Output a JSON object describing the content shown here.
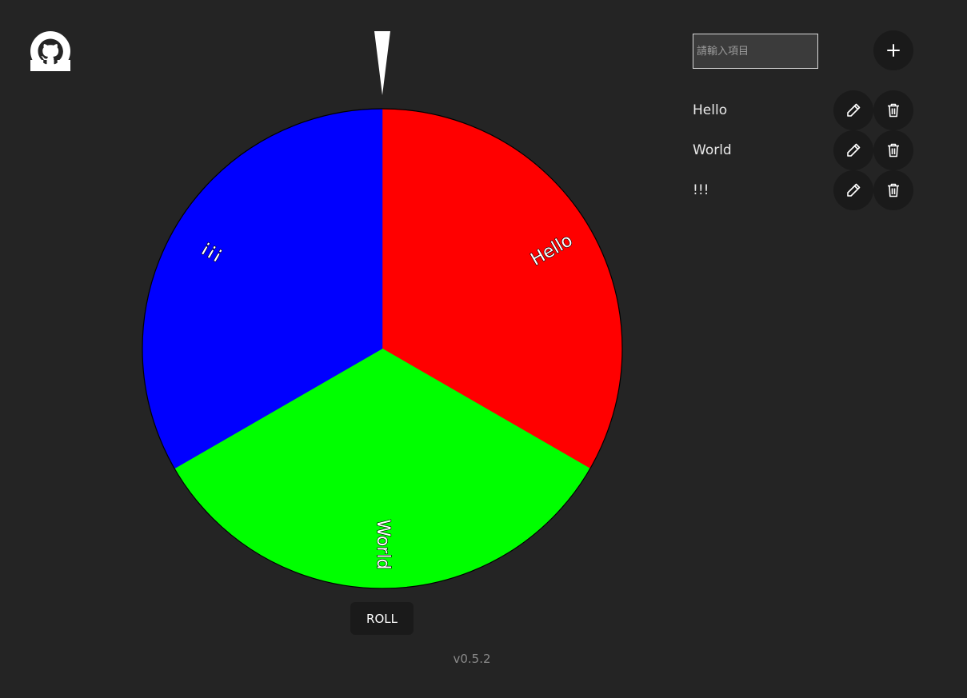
{
  "header": {
    "github_icon": "github-icon"
  },
  "wheel": {
    "pointer_icon": "pointer-triangle",
    "segments": [
      {
        "label": "Hello",
        "color": "#ff0000"
      },
      {
        "label": "World",
        "color": "#00ff00"
      },
      {
        "label": "!!!",
        "color": "#0000ff"
      }
    ],
    "outline_color": "#000000"
  },
  "controls": {
    "roll_label": "ROLL",
    "version": "v0.5.2"
  },
  "editor": {
    "input_placeholder": "請輸入項目",
    "input_value": "",
    "add_icon": "plus-icon",
    "edit_icon": "pencil-icon",
    "delete_icon": "trash-icon",
    "items": [
      {
        "label": "Hello"
      },
      {
        "label": "World"
      },
      {
        "label": "!!!"
      }
    ]
  }
}
